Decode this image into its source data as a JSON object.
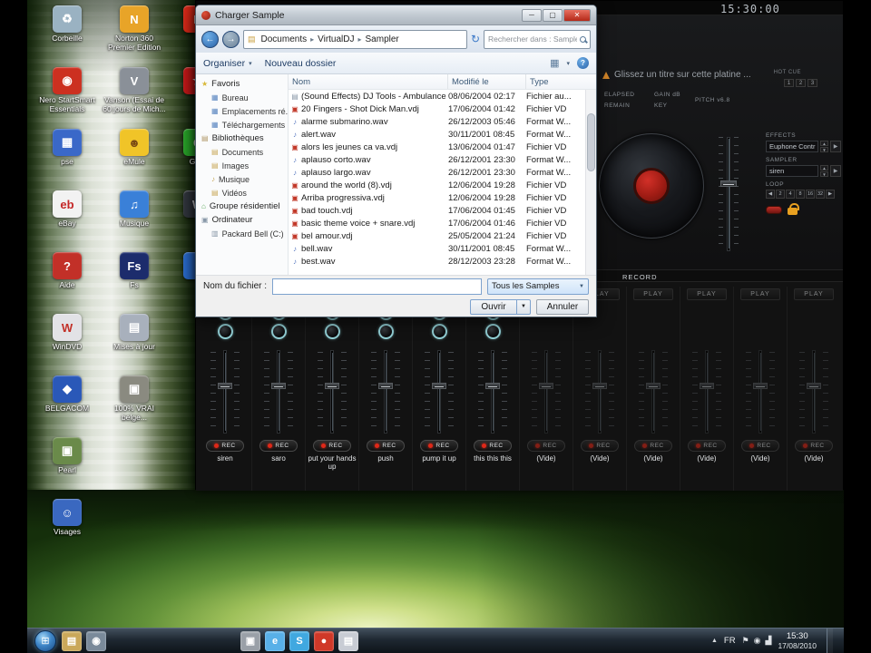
{
  "desktop": {
    "col1": [
      {
        "glyph": "♻",
        "color": "#9ab2c2",
        "label": "Corbeille"
      },
      {
        "glyph": "◉",
        "color": "#cc3020",
        "label": "Nero StartSmart Essentials"
      },
      {
        "glyph": "▦",
        "color": "#3a68c8",
        "label": "pse"
      },
      {
        "glyph": "eb",
        "color": "#f2f2f2",
        "fg": "#c42828",
        "label": "eBay"
      },
      {
        "glyph": "?",
        "color": "#c23028",
        "label": "Aide"
      },
      {
        "glyph": "W",
        "color": "#e2e2e6",
        "fg": "#c23028",
        "label": "WinDVD"
      },
      {
        "glyph": "◆",
        "color": "#2a58b8",
        "label": "BELGACOM"
      },
      {
        "glyph": "▣",
        "color": "#6a8a4a",
        "label": "Pearl"
      },
      {
        "glyph": "☺",
        "color": "#3a68c0",
        "label": "Visages"
      }
    ],
    "col2": [
      {
        "glyph": "N",
        "color": "#e8a428",
        "label": "Norton 360 Premier Edition"
      },
      {
        "glyph": "V",
        "color": "#8a9098",
        "label": "Vanson (Essai de 60 jours de Mich..."
      },
      {
        "glyph": "☻",
        "color": "#f0c428",
        "fg": "#7a4a14",
        "label": "eMule"
      },
      {
        "glyph": "♫",
        "color": "#3a80d8",
        "label": "Musique"
      },
      {
        "glyph": "Fs",
        "color": "#1c2c6c",
        "label": "Fs"
      },
      {
        "glyph": "▤",
        "color": "#a8b0bc",
        "label": "Mises à jour"
      },
      {
        "glyph": "▣",
        "color": "#8a8a80",
        "label": "100% VRAI belge..."
      }
    ],
    "col3": [
      {
        "glyph": "R",
        "color": "#d42818",
        "label": ""
      },
      {
        "glyph": "★",
        "color": "#c01818",
        "label": ""
      },
      {
        "glyph": "G",
        "color": "#28a028",
        "label": "Ga..."
      },
      {
        "glyph": "W",
        "color": "#30343c",
        "fg": "#e8e8ee",
        "label": ""
      },
      {
        "glyph": "●",
        "color": "#2868c8",
        "label": ""
      }
    ]
  },
  "dialog": {
    "title": "Charger Sample",
    "window_buttons": [
      "─",
      "▢",
      "✕"
    ],
    "back_glyph": "←",
    "forward_glyph": "→",
    "crumb_icon": "▤",
    "refresh_glyph": "↻",
    "breadcrumb": [
      {
        "label": "Documents",
        "sep": "▸"
      },
      {
        "label": "VirtualDJ",
        "sep": "▸"
      },
      {
        "label": "Sampler",
        "sep": ""
      }
    ],
    "search": {
      "placeholder": "Rechercher dans : Sampler"
    },
    "toolbar": {
      "organize": "Organiser",
      "organize_caret": "▾",
      "new_folder": "Nouveau dossier",
      "views_glyph": "▦",
      "views_caret": "▾",
      "help_glyph": "?"
    },
    "nav_items": [
      {
        "cls": "hdr",
        "glyph": "★",
        "gc": "#d8b838",
        "label": "Favoris"
      },
      {
        "cls": "sub",
        "glyph": "▦",
        "gc": "#5a86c0",
        "label": "Bureau"
      },
      {
        "cls": "sub",
        "glyph": "▦",
        "gc": "#5a86c0",
        "label": "Emplacements ré..."
      },
      {
        "cls": "sub",
        "glyph": "▦",
        "gc": "#5a86c0",
        "label": "Téléchargements"
      },
      {
        "cls": "hdr",
        "glyph": "▤",
        "gc": "#b09868",
        "label": "Bibliothèques"
      },
      {
        "cls": "sub",
        "glyph": "▤",
        "gc": "#c8a858",
        "label": "Documents"
      },
      {
        "cls": "sub",
        "glyph": "▤",
        "gc": "#c8a858",
        "label": "Images"
      },
      {
        "cls": "sub",
        "glyph": "♪",
        "gc": "#c8a858",
        "label": "Musique"
      },
      {
        "cls": "sub",
        "glyph": "▤",
        "gc": "#c8a858",
        "label": "Vidéos"
      },
      {
        "cls": "hdr",
        "glyph": "⌂",
        "gc": "#58a858",
        "label": "Groupe résidentiel"
      },
      {
        "cls": "hdr",
        "glyph": "▣",
        "gc": "#8898a8",
        "label": "Ordinateur"
      },
      {
        "cls": "sub",
        "glyph": "▥",
        "gc": "#8898a8",
        "label": "Packard Bell (C:)"
      }
    ],
    "columns": [
      "Nom",
      "Modifié le",
      "Type"
    ],
    "files": [
      {
        "icon": "▤",
        "icon_color": "#8a98a8",
        "name": "(Sound Effects) DJ Tools - Ambulance Pa...",
        "date": "08/06/2004 02:17",
        "type": "Fichier au..."
      },
      {
        "icon": "▣",
        "icon_color": "#c23828",
        "name": "20 Fingers - Shot Dick Man.vdj",
        "date": "17/06/2004 01:42",
        "type": "Fichier VD"
      },
      {
        "icon": "♪",
        "icon_color": "#5878c0",
        "name": "alarme submarino.wav",
        "date": "26/12/2003 05:46",
        "type": "Format W..."
      },
      {
        "icon": "♪",
        "icon_color": "#5878c0",
        "name": "alert.wav",
        "date": "30/11/2001 08:45",
        "type": "Format W..."
      },
      {
        "icon": "▣",
        "icon_color": "#c23828",
        "name": "alors les jeunes ca va.vdj",
        "date": "13/06/2004 01:47",
        "type": "Fichier VD"
      },
      {
        "icon": "♪",
        "icon_color": "#5878c0",
        "name": "aplauso corto.wav",
        "date": "26/12/2001 23:30",
        "type": "Format W..."
      },
      {
        "icon": "♪",
        "icon_color": "#5878c0",
        "name": "aplauso largo.wav",
        "date": "26/12/2001 23:30",
        "type": "Format W..."
      },
      {
        "icon": "▣",
        "icon_color": "#c23828",
        "name": "around the world (8).vdj",
        "date": "12/06/2004 19:28",
        "type": "Fichier VD"
      },
      {
        "icon": "▣",
        "icon_color": "#c23828",
        "name": "Arriba progressiva.vdj",
        "date": "12/06/2004 19:28",
        "type": "Fichier VD"
      },
      {
        "icon": "▣",
        "icon_color": "#c23828",
        "name": "bad touch.vdj",
        "date": "17/06/2004 01:45",
        "type": "Fichier VD"
      },
      {
        "icon": "▣",
        "icon_color": "#c23828",
        "name": "basic theme voice + snare.vdj",
        "date": "17/06/2004 01:46",
        "type": "Fichier VD"
      },
      {
        "icon": "▣",
        "icon_color": "#c23828",
        "name": "bel amour.vdj",
        "date": "25/05/2004 21:24",
        "type": "Fichier VD"
      },
      {
        "icon": "♪",
        "icon_color": "#5878c0",
        "name": "bell.wav",
        "date": "30/11/2001 08:45",
        "type": "Format W..."
      },
      {
        "icon": "♪",
        "icon_color": "#5878c0",
        "name": "best.wav",
        "date": "28/12/2003 23:28",
        "type": "Format W..."
      }
    ],
    "filename_label": "Nom du fichier :",
    "filetype_value": "Tous les Samples",
    "combo_caret": "▼",
    "open": "Ouvrir",
    "open_caret": "▼",
    "cancel": "Annuler"
  },
  "vdj": {
    "clock": "15:30:00",
    "window_buttons": [
      "≡",
      "▫",
      "✕"
    ],
    "deck_title": "Glissez un titre sur cette platine ...",
    "hot_cue_label": "HOT CUE",
    "hot_cues": [
      "1",
      "2",
      "3"
    ],
    "labels": {
      "elapsed": "ELAPSED",
      "gain": "GAIN dB",
      "remain": "REMAIN",
      "key": "KEY",
      "pitch": "PITCH v6.8"
    },
    "effects": {
      "label": "EFFECTS",
      "value": "Euphone Contr",
      "up": "▲",
      "down": "▼",
      "go": "▶"
    },
    "sampler": {
      "label": "SAMPLER",
      "value": "siren",
      "up": "▲",
      "down": "▼",
      "go": "▶"
    },
    "loop": {
      "label": "LOOP",
      "buttons": [
        "◀",
        "2",
        "4",
        "8",
        "16",
        "32",
        "▶"
      ]
    },
    "record_tab": "RECORD",
    "play_label": "PLAY",
    "rec_label": "REC",
    "channels": [
      {
        "name": "siren",
        "knobs": true,
        "cls": "loaded"
      },
      {
        "name": "saro",
        "knobs": true,
        "cls": "loaded"
      },
      {
        "name": "put your hands up",
        "knobs": true,
        "cls": "loaded"
      },
      {
        "name": "push",
        "knobs": true,
        "cls": "loaded"
      },
      {
        "name": "pump it up",
        "knobs": true,
        "cls": "loaded"
      },
      {
        "name": "this this this",
        "knobs": true,
        "cls": "loaded"
      },
      {
        "name": "(Vide)",
        "knobs": false,
        "cls": "empty"
      },
      {
        "name": "(Vide)",
        "knobs": false,
        "cls": "empty"
      },
      {
        "name": "(Vide)",
        "knobs": false,
        "cls": "empty"
      },
      {
        "name": "(Vide)",
        "knobs": false,
        "cls": "empty"
      },
      {
        "name": "(Vide)",
        "knobs": false,
        "cls": "empty"
      },
      {
        "name": "(Vide)",
        "knobs": false,
        "cls": "empty"
      }
    ]
  },
  "taskbar": {
    "start_glyph": "⊞",
    "left_icons": [
      {
        "glyph": "▤",
        "color": "#caa85a"
      },
      {
        "glyph": "◉",
        "color": "#7a8a9a"
      }
    ],
    "mid_icons": [
      {
        "glyph": "▣",
        "color": "#9aa0a8"
      },
      {
        "glyph": "e",
        "color": "#58b0e8"
      },
      {
        "glyph": "S",
        "color": "#40a8e0"
      },
      {
        "glyph": "●",
        "color": "#d03828"
      },
      {
        "glyph": "▤",
        "color": "#c8ccd4"
      }
    ],
    "tray": {
      "expand": "▲",
      "lang": "FR",
      "icons": [
        {
          "glyph": "⚑"
        },
        {
          "glyph": "◉"
        },
        {
          "glyph": "▟"
        }
      ],
      "time": "15:30",
      "date": "17/08/2010"
    }
  }
}
